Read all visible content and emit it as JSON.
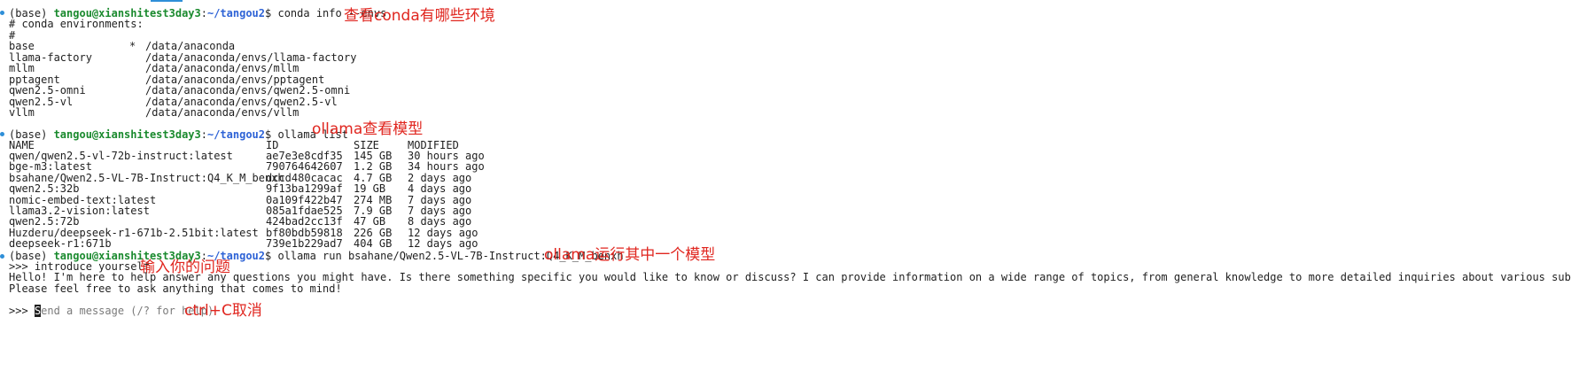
{
  "prompt": {
    "base": "(base) ",
    "user": "tangou@xianshitest3day3",
    "sep": ":",
    "path": "~/tangou2",
    "dollar": "$ "
  },
  "commands": {
    "conda_info": "conda info --envs",
    "ollama_list": "ollama list",
    "ollama_run": "ollama run bsahane/Qwen2.5-VL-7B-Instruct:Q4_K_M_benxh"
  },
  "conda": {
    "header1": "# conda environments:",
    "header2": "#",
    "envs": [
      {
        "name": "base",
        "marker": "*",
        "path": "/data/anaconda"
      },
      {
        "name": "llama-factory",
        "marker": "",
        "path": "/data/anaconda/envs/llama-factory"
      },
      {
        "name": "mllm",
        "marker": "",
        "path": "/data/anaconda/envs/mllm"
      },
      {
        "name": "pptagent",
        "marker": "",
        "path": "/data/anaconda/envs/pptagent"
      },
      {
        "name": "qwen2.5-omni",
        "marker": "",
        "path": "/data/anaconda/envs/qwen2.5-omni"
      },
      {
        "name": "qwen2.5-vl",
        "marker": "",
        "path": "/data/anaconda/envs/qwen2.5-vl"
      },
      {
        "name": "vllm",
        "marker": "",
        "path": "/data/anaconda/envs/vllm"
      }
    ]
  },
  "ollama_list": {
    "columns": [
      "NAME",
      "ID",
      "SIZE",
      "MODIFIED"
    ],
    "rows": [
      [
        "qwen/qwen2.5-vl-72b-instruct:latest",
        "ae7e3e8cdf35",
        "145 GB",
        "30 hours ago"
      ],
      [
        "bge-m3:latest",
        "790764642607",
        "1.2 GB",
        "34 hours ago"
      ],
      [
        "bsahane/Qwen2.5-VL-7B-Instruct:Q4_K_M_benxh",
        "dccd480cacac",
        "4.7 GB",
        "2 days ago"
      ],
      [
        "qwen2.5:32b",
        "9f13ba1299af",
        "19 GB",
        "4 days ago"
      ],
      [
        "nomic-embed-text:latest",
        "0a109f422b47",
        "274 MB",
        "7 days ago"
      ],
      [
        "llama3.2-vision:latest",
        "085a1fdae525",
        "7.9 GB",
        "7 days ago"
      ],
      [
        "qwen2.5:72b",
        "424bad2cc13f",
        "47 GB",
        "8 days ago"
      ],
      [
        "Huzderu/deepseek-r1-671b-2.51bit:latest",
        "bf80bdb59818",
        "226 GB",
        "12 days ago"
      ],
      [
        "deepseek-r1:671b",
        "739e1b229ad7",
        "404 GB",
        "12 days ago"
      ]
    ]
  },
  "chat": {
    "prompt_marker": ">>> ",
    "user_input": "introduce yourself",
    "response_line1": "Hello! I'm here to help answer any questions you might have. Is there something specific you would like to know or discuss? I can provide information on a wide range of topics, from general knowledge to more detailed inquiries about various subjects.",
    "response_line2": "Please feel free to ask anything that comes to mind!",
    "cursor_char": "S",
    "placeholder_rest": "end a message (/? for help)"
  },
  "annotations": {
    "conda_envs": "查看conda有哪些环境",
    "ollama_list": "ollama查看模型",
    "ollama_run": "ollama运行其中一个模型",
    "question": "输入你的问题",
    "cancel": "ctrl+C取消"
  },
  "colors": {
    "user": "#1a8a2e",
    "path": "#2e63d6",
    "annotation": "#e0261f",
    "dot": "#2f8fd8"
  }
}
